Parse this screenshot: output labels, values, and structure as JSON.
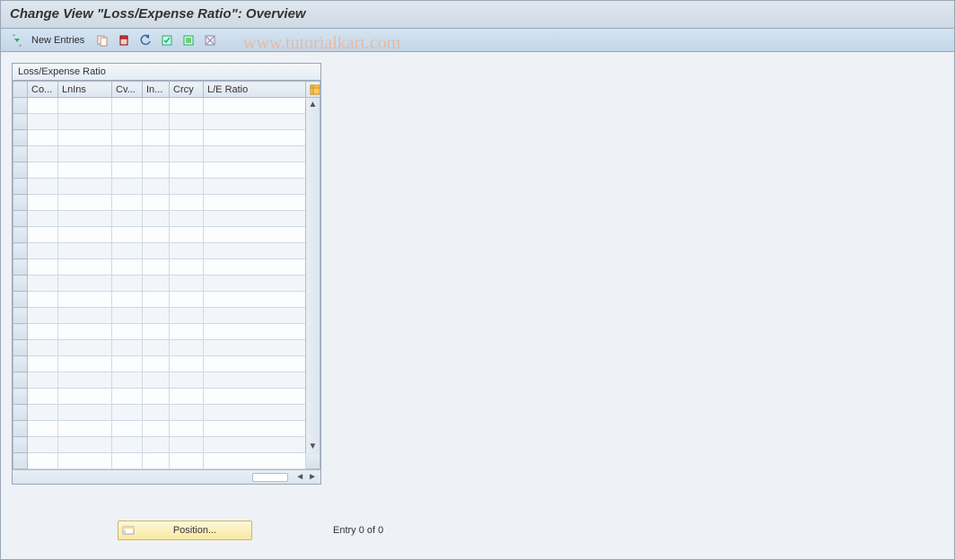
{
  "title": "Change View \"Loss/Expense Ratio\": Overview",
  "watermark": "www.tutorialkart.com",
  "toolbar": {
    "new_entries_label": "New Entries"
  },
  "table": {
    "title": "Loss/Expense Ratio",
    "columns": [
      "Co...",
      "LnIns",
      "Cv...",
      "In...",
      "Crcy",
      "L/E Ratio"
    ],
    "rows": []
  },
  "position_button": {
    "label": "Position..."
  },
  "entry_status": "Entry 0 of 0"
}
